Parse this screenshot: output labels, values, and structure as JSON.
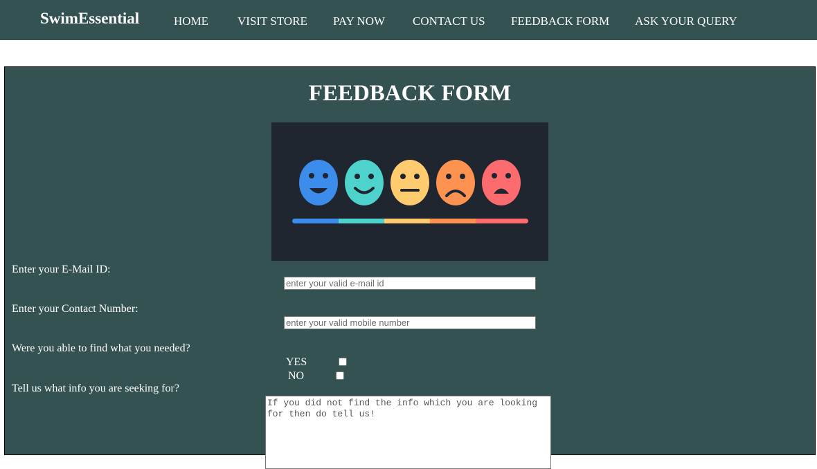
{
  "nav": {
    "brand": "SwimEssential",
    "items": [
      {
        "label": "HOME"
      },
      {
        "label": "VISIT STORE"
      },
      {
        "label": "PAY NOW"
      },
      {
        "label": "CONTACT US"
      },
      {
        "label": "FEEDBACK FORM"
      },
      {
        "label": "ASK YOUR QUERY"
      }
    ],
    "background": "#345251"
  },
  "form": {
    "title": "FEEDBACK FORM",
    "panel_background": "#345251",
    "hero_image": {
      "icon": "rating-faces-icon",
      "background": "#1f2630",
      "face_colors": [
        "#3c8cec",
        "#4ed2cc",
        "#fecb6e",
        "#fe9250",
        "#fc6b6e"
      ]
    },
    "email": {
      "label": "Enter your E-Mail ID:",
      "value": "",
      "placeholder": "enter your valid e-mail id"
    },
    "contact": {
      "label": "Enter your Contact Number:",
      "value": "",
      "placeholder": "enter your valid mobile number"
    },
    "found": {
      "label": "Were you able to find what you needed?",
      "yes_label": "YES",
      "no_label": "NO",
      "yes_checked": false,
      "no_checked": false
    },
    "seeking": {
      "label": "Tell us what info you are seeking for?",
      "value": "",
      "placeholder": "If you did not find the info which you are looking for then do tell us!"
    }
  }
}
